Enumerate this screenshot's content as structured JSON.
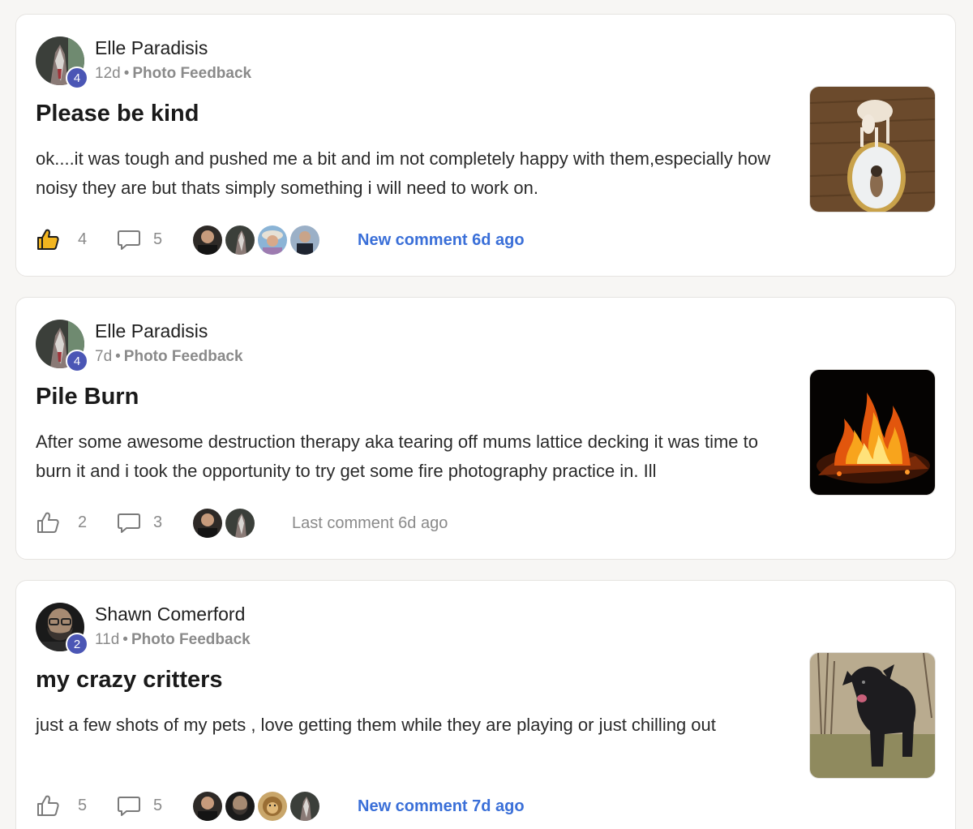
{
  "colors": {
    "accent_link": "#3a6fd8",
    "level_badge": "#4b56b5",
    "muted_text": "#8a8a8a",
    "like_active": "#f2b51f"
  },
  "posts": [
    {
      "author": "Elle Paradisis",
      "level": "4",
      "age": "12d",
      "separator": "•",
      "category": "Photo Feedback",
      "title": "Please be kind",
      "body": "ok....it was tough and pushed me a bit and im not completely happy with them,especially how noisy they are but thats simply something i will need to work on.",
      "likes": "4",
      "liked": true,
      "comments": "5",
      "activity": "New comment 6d ago",
      "activity_is_new": true,
      "thumbnail_icon": "dog-mirror-photo"
    },
    {
      "author": "Elle Paradisis",
      "level": "4",
      "age": "7d",
      "separator": "•",
      "category": "Photo Feedback",
      "title": "Pile Burn",
      "body": "After some awesome destruction therapy aka tearing off mums lattice decking it was time to burn it and i took the opportunity to try get some fire photography practice in. Ill",
      "likes": "2",
      "liked": false,
      "comments": "3",
      "activity": "Last comment 6d ago",
      "activity_is_new": false,
      "thumbnail_icon": "bonfire-photo"
    },
    {
      "author": "Shawn Comerford",
      "level": "2",
      "age": "11d",
      "separator": "•",
      "category": "Photo Feedback",
      "title": "my crazy critters",
      "body": "just a few shots of my pets , love getting them while they are playing or just chilling out",
      "likes": "5",
      "liked": false,
      "comments": "5",
      "activity": "New comment 7d ago",
      "activity_is_new": true,
      "thumbnail_icon": "black-dog-photo"
    }
  ]
}
